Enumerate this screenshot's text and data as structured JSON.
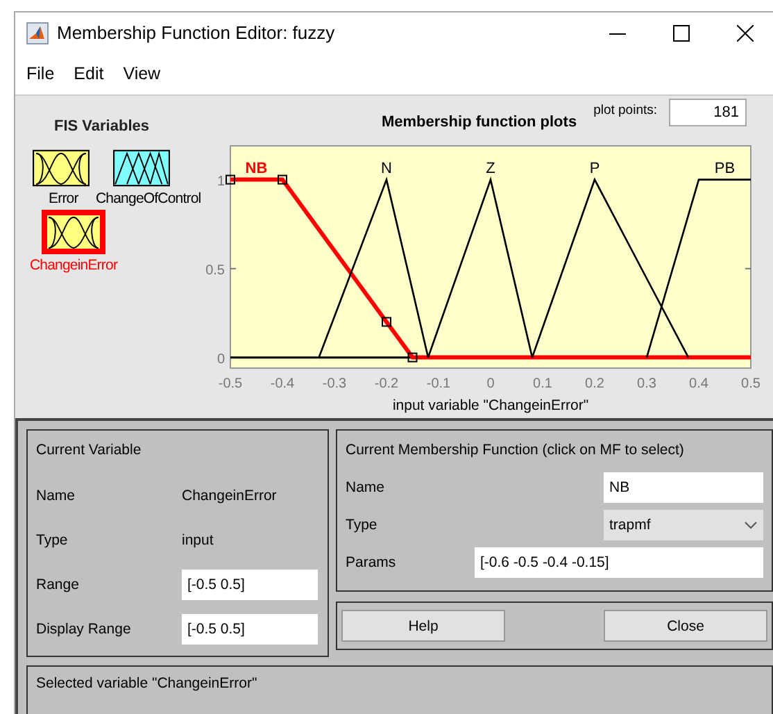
{
  "window": {
    "title": "Membership Function Editor: fuzzy"
  },
  "menu": [
    "File",
    "Edit",
    "View"
  ],
  "fis_variables": {
    "title": "FIS Variables",
    "items": [
      {
        "name": "Error",
        "kind": "input",
        "selected": false
      },
      {
        "name": "ChangeOfControl",
        "kind": "output",
        "selected": false
      },
      {
        "name": "ChangeinError",
        "kind": "input",
        "selected": true
      }
    ]
  },
  "plot": {
    "plot_points_label": "plot points:",
    "plot_points": "181",
    "chart_data": {
      "type": "line",
      "title": "Membership function plots",
      "xlabel": "input variable \"ChangeinError\"",
      "x": [
        -0.5,
        -0.4,
        -0.33,
        -0.2,
        -0.15,
        -0.12,
        0,
        0.08,
        0.2,
        0.3,
        0.38,
        0.4,
        0.5
      ],
      "series": [
        {
          "name": "NB",
          "color": "#ff0000",
          "values": [
            1,
            1,
            0.72,
            0.2,
            0,
            0,
            0,
            0,
            0,
            0,
            0,
            0,
            0
          ]
        },
        {
          "name": "N",
          "color": "#000000",
          "values": [
            null,
            null,
            0,
            1,
            0.375,
            0,
            null,
            null,
            null,
            null,
            null,
            null,
            null
          ]
        },
        {
          "name": "Z",
          "color": "#000000",
          "values": [
            null,
            null,
            null,
            null,
            null,
            0,
            1,
            0,
            null,
            null,
            null,
            null,
            null
          ]
        },
        {
          "name": "P",
          "color": "#000000",
          "values": [
            null,
            null,
            null,
            null,
            null,
            null,
            null,
            0,
            1,
            0.444,
            0,
            null,
            null
          ]
        },
        {
          "name": "PB",
          "color": "#000000",
          "values": [
            null,
            null,
            null,
            null,
            null,
            null,
            null,
            null,
            null,
            0,
            0.8,
            1,
            1
          ]
        }
      ],
      "xlim": [
        -0.5,
        0.5
      ],
      "ylim": [
        -0.06,
        1.19
      ],
      "xticks": [
        -0.5,
        -0.4,
        -0.3,
        -0.2,
        -0.1,
        0,
        0.1,
        0.2,
        0.3,
        0.4,
        0.5
      ],
      "yticks": [
        0,
        0.5,
        1
      ]
    },
    "curves": [
      {
        "selected": true
      },
      {
        "selected": false
      },
      {
        "selected": false
      },
      {
        "selected": false
      },
      {
        "selected": false
      }
    ]
  },
  "current_variable": {
    "title": "Current Variable",
    "name_label": "Name",
    "name": "ChangeinError",
    "type_label": "Type",
    "type": "input",
    "range_label": "Range",
    "range": "[-0.5 0.5]",
    "display_range_label": "Display Range",
    "display_range": "[-0.5 0.5]"
  },
  "current_mf": {
    "title": "Current Membership Function (click on MF to select)",
    "name_label": "Name",
    "name": "NB",
    "type_label": "Type",
    "type": "trapmf",
    "params_label": "Params",
    "params": "[-0.6 -0.5 -0.4 -0.15]"
  },
  "buttons": [
    "Help",
    "Close"
  ],
  "status": "Selected variable \"ChangeinError\""
}
